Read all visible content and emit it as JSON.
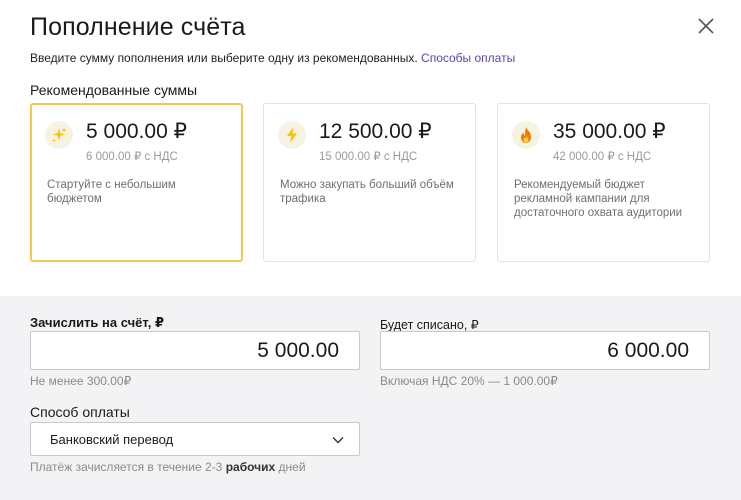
{
  "dialog": {
    "title": "Пополнение счёта",
    "subtitle_text": "Введите сумму пополнения или выберите одну из рекомендованных.",
    "subtitle_link": "Способы оплаты",
    "close_icon": "close-icon"
  },
  "recommended": {
    "heading": "Рекомендованные суммы",
    "cards": [
      {
        "amount": "5 000.00 ₽",
        "vat": "6 000.00 ₽ с НДС",
        "description": "Стартуйте с небольшим бюджетом",
        "icon": "sparkles-icon",
        "selected": true
      },
      {
        "amount": "12 500.00 ₽",
        "vat": "15 000.00 ₽ с НДС",
        "description": "Можно закупать больший объём трафика",
        "icon": "lightning-icon",
        "selected": false
      },
      {
        "amount": "35 000.00 ₽",
        "vat": "42 000.00 ₽ с НДС",
        "description": "Рекомендуемый бюджет рекламной кампании для достаточного охвата аудитории",
        "icon": "fire-icon",
        "selected": false
      }
    ]
  },
  "form": {
    "credit_label": "Зачислить на счёт, ₽",
    "credit_value": "5 000.00",
    "credit_hint": "Не менее 300.00₽",
    "debit_label": "Будет списано, ₽",
    "debit_value": "6 000.00",
    "debit_hint": "Включая НДС 20% — 1 000.00₽",
    "payment_label": "Способ оплаты",
    "payment_selected": "Банковский перевод",
    "payment_hint_before": "Платёж зачисляется в течение 2-3",
    "payment_hint_bold": "рабочих",
    "payment_hint_after": "дней"
  },
  "colors": {
    "accent_link": "#5b44b5",
    "selected_border": "#f2c94c",
    "icon_yellow": "#f5c400",
    "icon_orange": "#f27c00"
  }
}
